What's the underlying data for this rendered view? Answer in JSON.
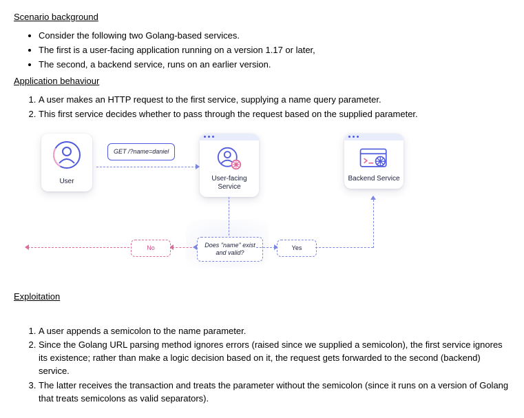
{
  "sections": {
    "background_heading": "Scenario background",
    "background_bullets": [
      "Consider the following two Golang-based services.",
      "The first is a user-facing application running on a version 1.17 or later,",
      "The second, a backend service, runs on an earlier version."
    ],
    "behaviour_heading": "Application behaviour",
    "behaviour_steps": [
      "A user makes an HTTP request to the first service, supplying a name query parameter.",
      "This first service decides whether to pass through the request based on the supplied parameter."
    ],
    "exploitation_heading": "Exploitation",
    "exploitation_steps": [
      "A user appends a semicolon to the name parameter.",
      "Since the Golang URL parsing method ignores errors (raised since we supplied a semicolon), the first service ignores its existence; rather than make a logic decision based on it, the request gets forwarded to the second (backend) service.",
      "The latter receives the transaction and treats the parameter without the semicolon (since it runs on a version of Golang that treats semicolons as valid separators)."
    ]
  },
  "diagram": {
    "user_label": "User",
    "frontend_label": "User-facing Service",
    "backend_label": "Backend Service",
    "request_text": "GET /?name=daniel",
    "decision_text": "Does \"name\" exist and valid?",
    "yes_label": "Yes",
    "no_label": "No"
  }
}
